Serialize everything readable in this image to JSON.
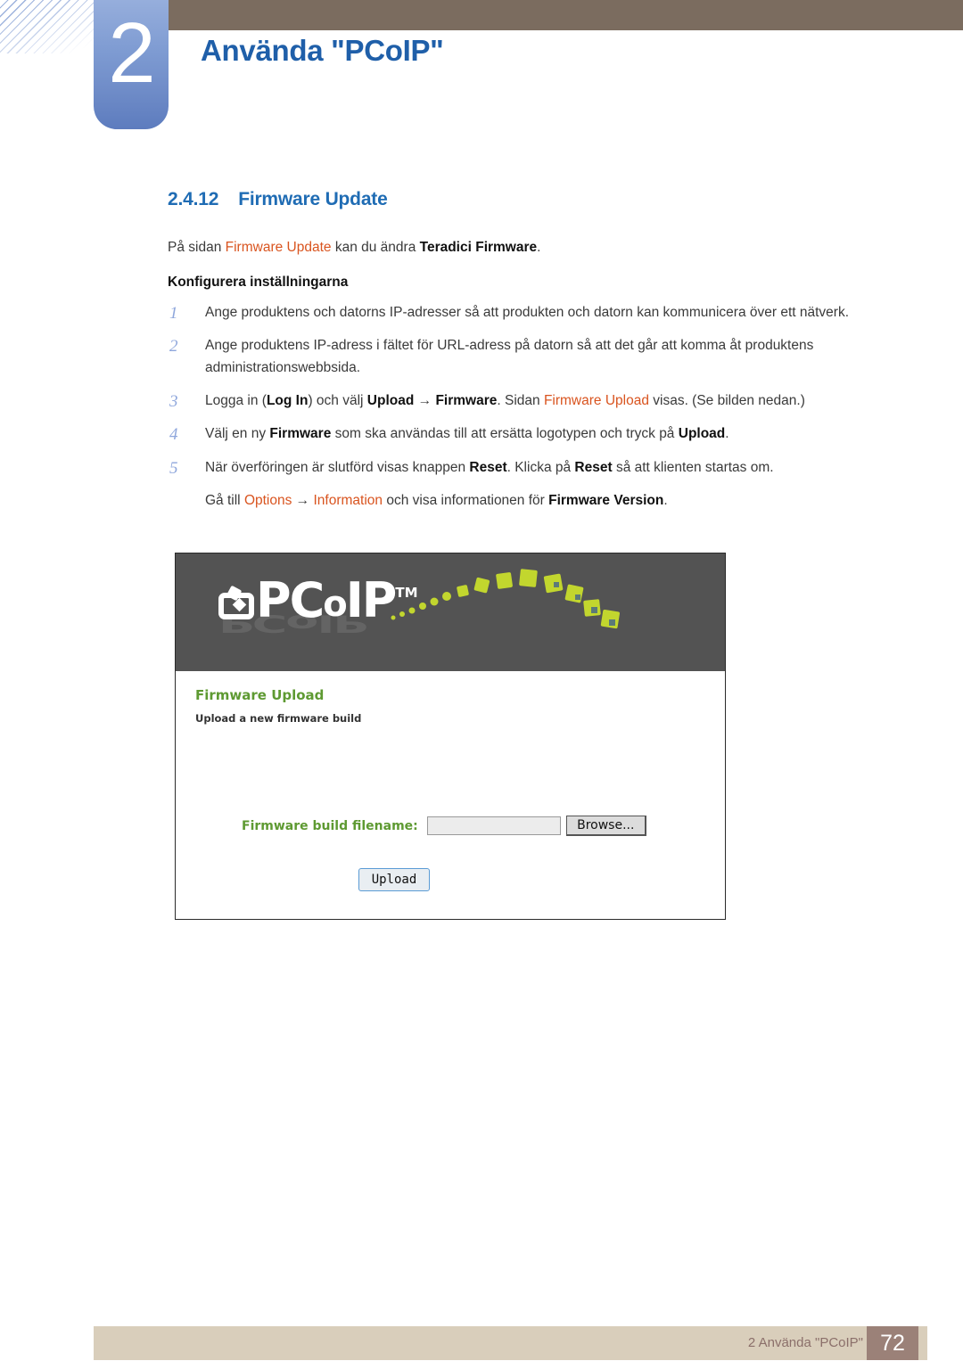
{
  "header": {
    "chapter_number": "2",
    "chapter_title": "Använda \"PCoIP\"",
    "accent_blue": "#1f5fa9",
    "bar_brown": "#7b6c5f"
  },
  "section": {
    "number": "2.4.12",
    "title": "Firmware Update",
    "heading_color": "#1f6cb4"
  },
  "intro": {
    "pre": "På sidan ",
    "link": "Firmware Update",
    "mid": " kan du ändra ",
    "bold": "Teradici Firmware",
    "post": "."
  },
  "subheading": "Konfigurera inställningarna",
  "steps": [
    {
      "num": "1",
      "parts": [
        {
          "text": "Ange produktens och datorns IP-adresser så att produkten och datorn kan kommunicera över ett nätverk.",
          "style": "normal"
        }
      ]
    },
    {
      "num": "2",
      "parts": [
        {
          "text": "Ange produktens IP-adress i fältet för URL-adress på datorn så att det går att komma åt produktens administrationswebbsida.",
          "style": "normal"
        }
      ]
    },
    {
      "num": "3",
      "parts": [
        {
          "text": "Logga in (",
          "style": "normal"
        },
        {
          "text": "Log In",
          "style": "bold"
        },
        {
          "text": ") och välj ",
          "style": "normal"
        },
        {
          "text": "Upload",
          "style": "bold"
        },
        {
          "text": " → ",
          "style": "normal"
        },
        {
          "text": "Firmware",
          "style": "bold"
        },
        {
          "text": ". Sidan ",
          "style": "normal"
        },
        {
          "text": "Firmware Upload",
          "style": "orange"
        },
        {
          "text": " visas. (Se bilden nedan.)",
          "style": "normal"
        }
      ]
    },
    {
      "num": "4",
      "parts": [
        {
          "text": "Välj en ny ",
          "style": "normal"
        },
        {
          "text": "Firmware",
          "style": "bold"
        },
        {
          "text": " som ska användas till att ersätta logotypen och tryck på ",
          "style": "normal"
        },
        {
          "text": "Upload",
          "style": "bold"
        },
        {
          "text": ".",
          "style": "normal"
        }
      ]
    },
    {
      "num": "5",
      "parts": [
        {
          "text": "När överföringen är slutförd visas knappen ",
          "style": "normal"
        },
        {
          "text": "Reset",
          "style": "bold"
        },
        {
          "text": ". Klicka på ",
          "style": "normal"
        },
        {
          "text": "Reset",
          "style": "bold"
        },
        {
          "text": " så att klienten startas om.",
          "style": "normal"
        }
      ]
    }
  ],
  "step_extra": [
    {
      "text": "Gå till ",
      "style": "normal"
    },
    {
      "text": "Options",
      "style": "orange"
    },
    {
      "text": " → ",
      "style": "normal"
    },
    {
      "text": "Information",
      "style": "orange"
    },
    {
      "text": " och visa informationen för ",
      "style": "normal"
    },
    {
      "text": "Firmware Version",
      "style": "bold"
    },
    {
      "text": ".",
      "style": "normal"
    }
  ],
  "screenshot": {
    "logo_text": "PC",
    "logo_lower": "o",
    "logo_ip": "IP",
    "logo_tm": "TM",
    "banner_color": "#535353",
    "heading": "Firmware Upload",
    "subtext": "Upload a new firmware build",
    "field_label": "Firmware build filename:",
    "field_value": "",
    "browse_button": "Browse...",
    "upload_button": "Upload",
    "green": "#5e9a32"
  },
  "footer": {
    "text": "2 Använda \"PCoIP\"",
    "page_number": "72",
    "bar_color": "#d9cebb",
    "page_block_color": "#9b8178"
  }
}
